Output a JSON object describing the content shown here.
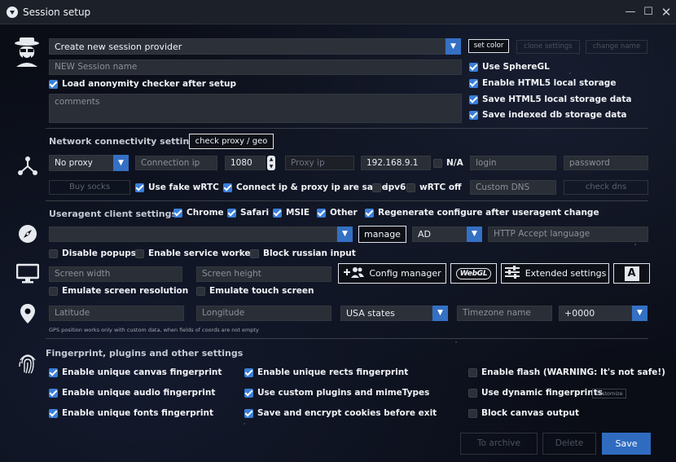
{
  "window": {
    "title": "Session setup"
  },
  "top": {
    "provider_select": "Create new session provider",
    "set_color": "set color",
    "clone_settings": "clone settings",
    "change_name": "change name",
    "session_name_placeholder": "NEW Session name",
    "load_anonymity": "Load anonymity checker after setup",
    "comments_placeholder": "comments",
    "use_sphere_gl": "Use SphereGL",
    "enable_html5_storage": "Enable HTML5 local storage",
    "save_html5_storage": "Save HTML5 local storage data",
    "save_indexed_db": "Save indexed db storage data"
  },
  "network": {
    "title": "Network connectivity settings",
    "check_proxy": "check proxy / geo",
    "proxy_type": "No proxy",
    "connection_ip_placeholder": "Connection ip",
    "port": "1080",
    "proxy_ip_placeholder": "Proxy ip",
    "ip_value": "192.168.9.1",
    "na": "N/A",
    "login_placeholder": "login",
    "password_placeholder": "password",
    "buy_socks": "Buy socks",
    "use_fake_webrtc": "Use fake wRTC",
    "connect_ip_same": "Connect ip & proxy ip are same",
    "ipv6": "ipv6",
    "webrtc_off": "wRTC off",
    "custom_dns_placeholder": "Custom DNS",
    "check_dns": "check dns"
  },
  "useragent": {
    "title": "Useragent client settings",
    "chrome": "Chrome",
    "safari": "Safari",
    "msie": "MSIE",
    "other": "Other",
    "regenerate": "Regenerate configure after useragent change",
    "manage": "manage",
    "lang_select": "AD",
    "http_accept_placeholder": "HTTP Accept language",
    "disable_popups": "Disable popups",
    "enable_service_worker": "Enable service worker",
    "block_russian_input": "Block russian input"
  },
  "screen": {
    "width_placeholder": "Screen width",
    "height_placeholder": "Screen height",
    "config_manager": "Config manager",
    "webgl": "WebGL",
    "extended_settings": "Extended settings",
    "font_button": "A",
    "emulate_resolution": "Emulate screen resolution",
    "emulate_touch": "Emulate touch screen"
  },
  "geo": {
    "latitude_placeholder": "Latitude",
    "longitude_placeholder": "Longitude",
    "region_select": "USA states",
    "timezone_placeholder": "Timezone name",
    "offset_select": "+0000",
    "note": "GPS position works only with custom data, when fields of coords are not empty"
  },
  "fingerprint": {
    "title": "Fingerprint, plugins and other settings",
    "canvas": "Enable unique canvas fingerprint",
    "audio": "Enable unique audio fingerprint",
    "fonts": "Enable unique fonts fingerprint",
    "rects": "Enable unique rects fingerprint",
    "plugins": "Use custom plugins and mimeTypes",
    "cookies": "Save and encrypt cookies before exit",
    "flash": "Enable flash (WARNING: It's not safe!)",
    "dynamic": "Use dynamic fingerprints",
    "customize": "customize",
    "block_canvas": "Block canvas output"
  },
  "footer": {
    "to_archive": "To archive",
    "delete": "Delete",
    "save": "Save"
  },
  "colors": {
    "accent": "#3a7fd8",
    "select": "#3470c4",
    "input_bg": "#2a2e36"
  }
}
